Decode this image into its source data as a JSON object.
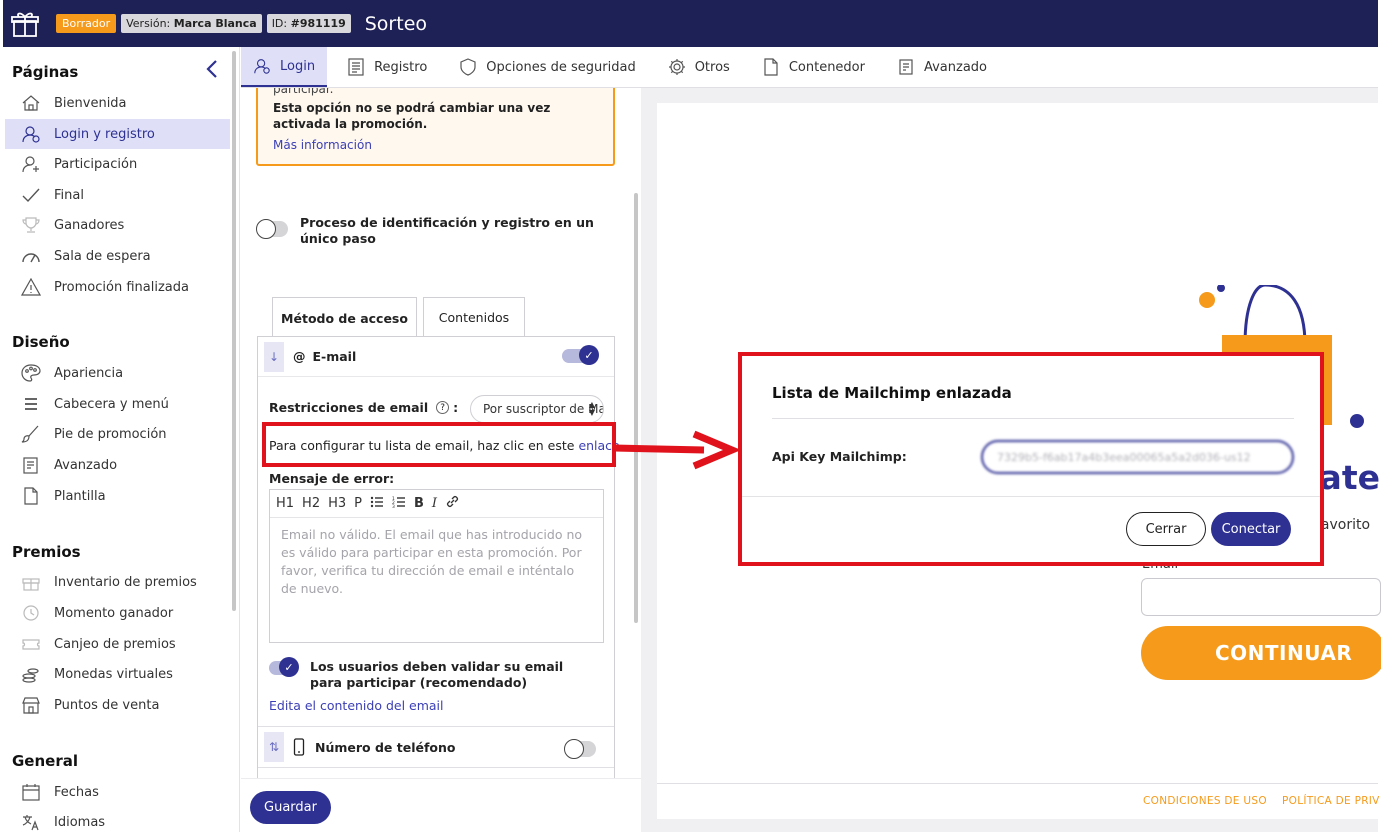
{
  "header": {
    "status_badge": "Borrador",
    "version_label": "Versión:",
    "version_value": "Marca Blanca",
    "id_label": "ID:",
    "id_value": "#981119",
    "title": "Sorteo"
  },
  "sidebar": {
    "sections": [
      {
        "title": "Páginas",
        "items": [
          {
            "label": "Bienvenida",
            "icon": "home-icon"
          },
          {
            "label": "Login y registro",
            "icon": "user-login-icon",
            "active": true
          },
          {
            "label": "Participación",
            "icon": "user-add-icon"
          },
          {
            "label": "Final",
            "icon": "checkmark-icon"
          },
          {
            "label": "Ganadores",
            "icon": "trophy-icon"
          },
          {
            "label": "Sala de espera",
            "icon": "gauge-icon"
          },
          {
            "label": "Promoción finalizada",
            "icon": "warning-icon"
          }
        ]
      },
      {
        "title": "Diseño",
        "items": [
          {
            "label": "Apariencia",
            "icon": "palette-icon"
          },
          {
            "label": "Cabecera y menú",
            "icon": "menu-icon"
          },
          {
            "label": "Pie de promoción",
            "icon": "brush-icon"
          },
          {
            "label": "Avanzado",
            "icon": "code-document-icon"
          },
          {
            "label": "Plantilla",
            "icon": "document-icon"
          }
        ]
      },
      {
        "title": "Premios",
        "items": [
          {
            "label": "Inventario de premios",
            "icon": "gift-icon"
          },
          {
            "label": "Momento ganador",
            "icon": "clock-icon"
          },
          {
            "label": "Canjeo de premios",
            "icon": "ticket-icon"
          },
          {
            "label": "Monedas virtuales",
            "icon": "coins-icon"
          },
          {
            "label": "Puntos de venta",
            "icon": "store-icon"
          }
        ]
      },
      {
        "title": "General",
        "items": [
          {
            "label": "Fechas",
            "icon": "calendar-icon"
          },
          {
            "label": "Idiomas",
            "icon": "translate-icon"
          }
        ]
      }
    ]
  },
  "tabs": [
    {
      "label": "Login",
      "icon": "user-login-icon",
      "active": true
    },
    {
      "label": "Registro",
      "icon": "form-icon"
    },
    {
      "label": "Opciones de seguridad",
      "icon": "shield-icon"
    },
    {
      "label": "Otros",
      "icon": "gear-icon"
    },
    {
      "label": "Contenedor",
      "icon": "document-icon"
    },
    {
      "label": "Avanzado",
      "icon": "code-document-icon"
    }
  ],
  "config": {
    "warning_cut": "participar.",
    "warning_bold": "Esta opción no se podrá cambiar una vez activada la promoción.",
    "warning_link": "Más información",
    "single_step_label": "Proceso de identificación y registro en un único paso",
    "single_step_on": false,
    "subtabs": [
      "Método de acceso",
      "Contenidos"
    ],
    "email_method": {
      "symbol": "@",
      "title": "E-mail",
      "enabled": true,
      "restrictions_label": "Restricciones de email",
      "restrictions_value": "Por suscriptor de Mailchimp",
      "config_text": "Para configurar tu lista de email, haz clic en este ",
      "config_link": "enlace",
      "config_end": ".",
      "error_label": "Mensaje de error:",
      "toolbar": [
        "H1",
        "H2",
        "H3",
        "P",
        "B",
        "I"
      ],
      "error_text": "Email no válido. El email que has introducido no es válido para participar en esta promoción. Por favor, verifica tu dirección de email e inténtalo de nuevo.",
      "validate_label": "Los usuarios deben validar su email para participar (recomendado)",
      "validate_on": true,
      "edit_link": "Edita el contenido del email"
    },
    "phone_method": {
      "title": "Número de teléfono",
      "enabled": false
    },
    "save_label": "Guardar"
  },
  "preview": {
    "heading_fragment": "cate",
    "sub_fragment": "favorito",
    "email_label": "Email",
    "continue_label": "CONTINUAR",
    "footer_links": [
      "CONDICIONES DE USO",
      "POLÍTICA DE PRIV"
    ]
  },
  "modal": {
    "title": "Lista de Mailchimp enlazada",
    "api_label": "Api Key Mailchimp:",
    "api_value": "7329b5-f6ab17a4b3eea00065a5a2d036-us12",
    "close_label": "Cerrar",
    "connect_label": "Conectar"
  },
  "colors": {
    "navy": "#1e2156",
    "primary": "#2e3192",
    "accent": "#f59a1a",
    "highlight_red": "#e0121b"
  }
}
